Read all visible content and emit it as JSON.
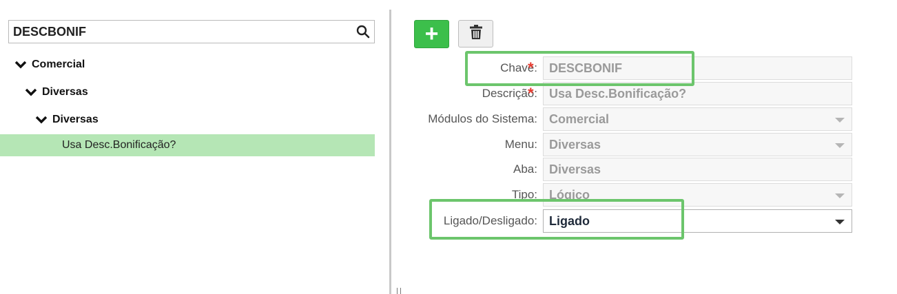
{
  "search": {
    "value": "DESCBONIF"
  },
  "tree": {
    "nodes": [
      {
        "label": "Comercial"
      },
      {
        "label": "Diversas"
      },
      {
        "label": "Diversas"
      }
    ],
    "selected_leaf": "Usa Desc.Bonificação?"
  },
  "toolbar": {
    "add_symbol": "+"
  },
  "form": {
    "required_mark": "*",
    "chave": {
      "label": "Chave:",
      "value": "DESCBONIF"
    },
    "descricao": {
      "label": "Descrição:",
      "value": "Usa Desc.Bonificação?"
    },
    "modulos": {
      "label": "Módulos do Sistema:",
      "value": "Comercial"
    },
    "menu": {
      "label": "Menu:",
      "value": "Diversas"
    },
    "aba": {
      "label": "Aba:",
      "value": "Diversas"
    },
    "tipo": {
      "label": "Tipo:",
      "value": "Lógico"
    },
    "ligado": {
      "label": "Ligado/Desligado:",
      "value": "Ligado"
    }
  },
  "colors": {
    "accent_green": "#3cbf4b",
    "selection": "#b5e6b5",
    "highlight_box": "#6cc56c",
    "required": "#e63a2f"
  }
}
